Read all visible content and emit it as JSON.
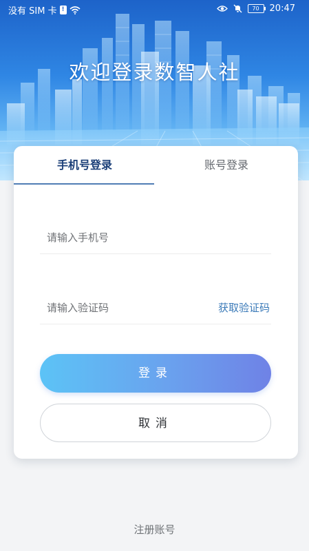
{
  "status_bar": {
    "carrier": "没有 SIM 卡",
    "sim_icon": "sim-card-icon",
    "wifi_icon": "wifi-icon",
    "eye_icon": "eye-comfort-icon",
    "mute_icon": "bell-muted-icon",
    "battery": "70",
    "time": "20:47"
  },
  "banner": {
    "title": "欢迎登录数智人社"
  },
  "login_card": {
    "tabs": [
      {
        "label": "手机号登录",
        "active": true
      },
      {
        "label": "账号登录",
        "active": false
      }
    ],
    "phone_field": {
      "value": "",
      "placeholder": "请输入手机号"
    },
    "code_field": {
      "value": "",
      "placeholder": "请输入验证码"
    },
    "get_code_label": "获取验证码",
    "login_button": "登录",
    "cancel_button": "取消"
  },
  "footer": {
    "register_link": "注册账号"
  },
  "colors": {
    "accent": "#3b7ab8",
    "tab_active": "#1b3f78",
    "login_gradient_start": "#5cc3f6",
    "login_gradient_end": "#6f82e6",
    "banner_top": "#1d63c9",
    "banner_bottom": "#a6d8fb"
  }
}
